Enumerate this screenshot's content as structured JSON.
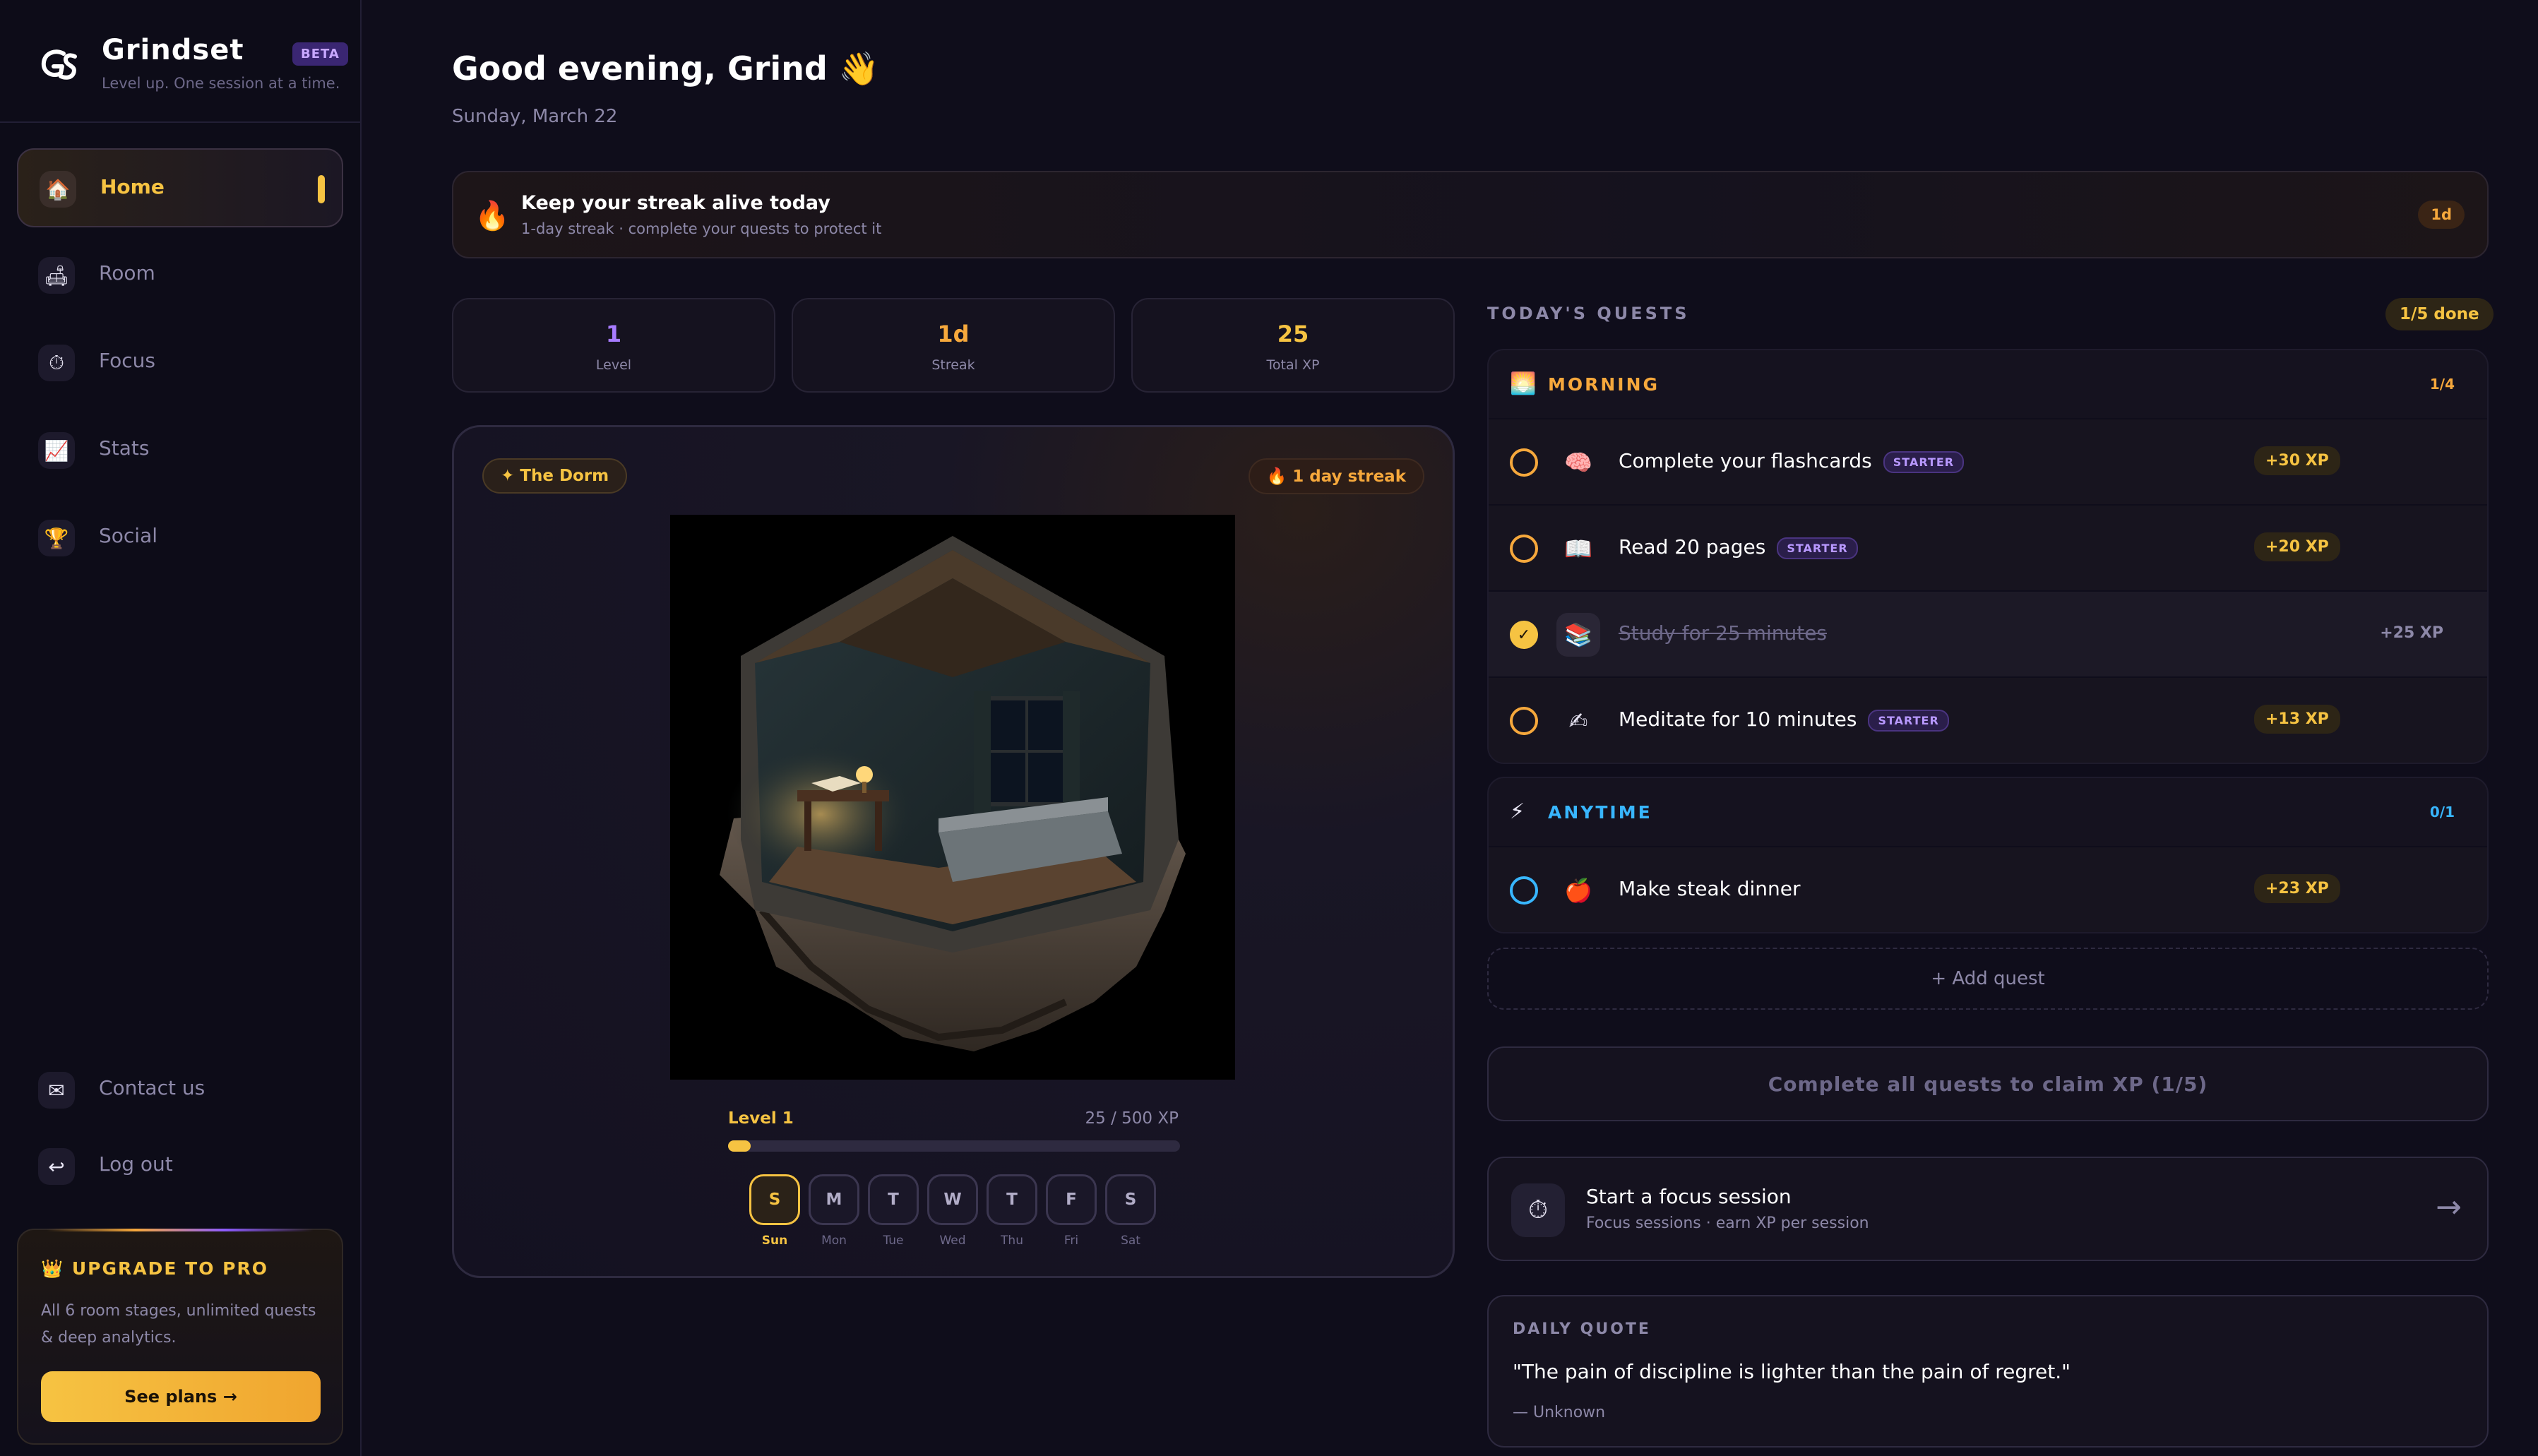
{
  "brand": {
    "name": "Grindset",
    "badge": "BETA",
    "tagline": "Level up. One session at a time."
  },
  "nav": {
    "items": [
      {
        "label": "Home",
        "icon": "🏠",
        "icon_name": "house-icon",
        "active": true
      },
      {
        "label": "Room",
        "icon": "🛋",
        "icon_name": "couch-icon"
      },
      {
        "label": "Focus",
        "icon": "⏱",
        "icon_name": "stopwatch-icon"
      },
      {
        "label": "Stats",
        "icon": "📈",
        "icon_name": "chart-icon"
      },
      {
        "label": "Social",
        "icon": "🏆",
        "icon_name": "trophy-icon"
      }
    ],
    "contact": {
      "label": "Contact us",
      "icon": "✉",
      "icon_name": "mail-icon"
    },
    "logout": {
      "label": "Log out",
      "icon": "↩",
      "icon_name": "logout-icon"
    }
  },
  "upgrade": {
    "icon": "👑",
    "title": "UPGRADE TO PRO",
    "description": "All 6 room stages, unlimited quests & deep analytics.",
    "button": "See plans →"
  },
  "header": {
    "greeting": "Good evening, Grind 👋",
    "date": "Sunday, March 22"
  },
  "banner": {
    "icon": "🔥",
    "title": "Keep your streak alive today",
    "subtitle": "1-day streak · complete your quests to protect it",
    "badge": "1d"
  },
  "stats": [
    {
      "value": "1",
      "label": "Level",
      "color": "#a77bff"
    },
    {
      "value": "1d",
      "label": "Streak",
      "color": "#f6a83c"
    },
    {
      "value": "25",
      "label": "Total XP",
      "color": "#f6c342"
    }
  ],
  "room": {
    "tag": "✦ The Dorm",
    "streak": "🔥 1 day streak",
    "level_label": "Level 1",
    "xp_label": "25 / 500 XP",
    "xp_progress": 0.05,
    "days": [
      {
        "letter": "S",
        "name": "Sun",
        "active": true
      },
      {
        "letter": "M",
        "name": "Mon"
      },
      {
        "letter": "T",
        "name": "Tue"
      },
      {
        "letter": "W",
        "name": "Wed"
      },
      {
        "letter": "T",
        "name": "Thu"
      },
      {
        "letter": "F",
        "name": "Fri"
      },
      {
        "letter": "S",
        "name": "Sat"
      }
    ]
  },
  "quests": {
    "title": "TODAY'S QUESTS",
    "done_badge": "1/5 done",
    "morning": {
      "icon": "🌅",
      "name": "MORNING",
      "count": "1/4",
      "color": "#f6a83c",
      "items": [
        {
          "emoji": "🧠",
          "name": "Complete your flashcards",
          "tag": "STARTER",
          "xp": "+30 XP",
          "done": false
        },
        {
          "emoji": "📖",
          "name": "Read 20 pages",
          "tag": "STARTER",
          "xp": "+20 XP",
          "done": false
        },
        {
          "emoji": "📚",
          "name": "Study for 25 minutes",
          "tag": "",
          "xp": "+25 XP",
          "done": true
        },
        {
          "emoji": "✍",
          "name": "Meditate for 10 minutes",
          "tag": "STARTER",
          "xp": "+13 XP",
          "done": false
        }
      ]
    },
    "anytime": {
      "icon": "⚡",
      "name": "ANYTIME",
      "count": "0/1",
      "color": "#38b6ff",
      "items": [
        {
          "emoji": "🍎",
          "name": "Make steak dinner",
          "tag": "",
          "xp": "+23 XP",
          "done": false
        }
      ]
    },
    "add_label": "+ Add quest",
    "claim_label": "Complete all quests to claim XP (1/5)"
  },
  "focus": {
    "icon": "⏱",
    "title": "Start a focus session",
    "subtitle": "Focus sessions · earn XP per session",
    "arrow": "→"
  },
  "quote": {
    "label": "DAILY QUOTE",
    "text": "\"The pain of discipline is lighter than the pain of regret.\"",
    "author": "— Unknown"
  }
}
